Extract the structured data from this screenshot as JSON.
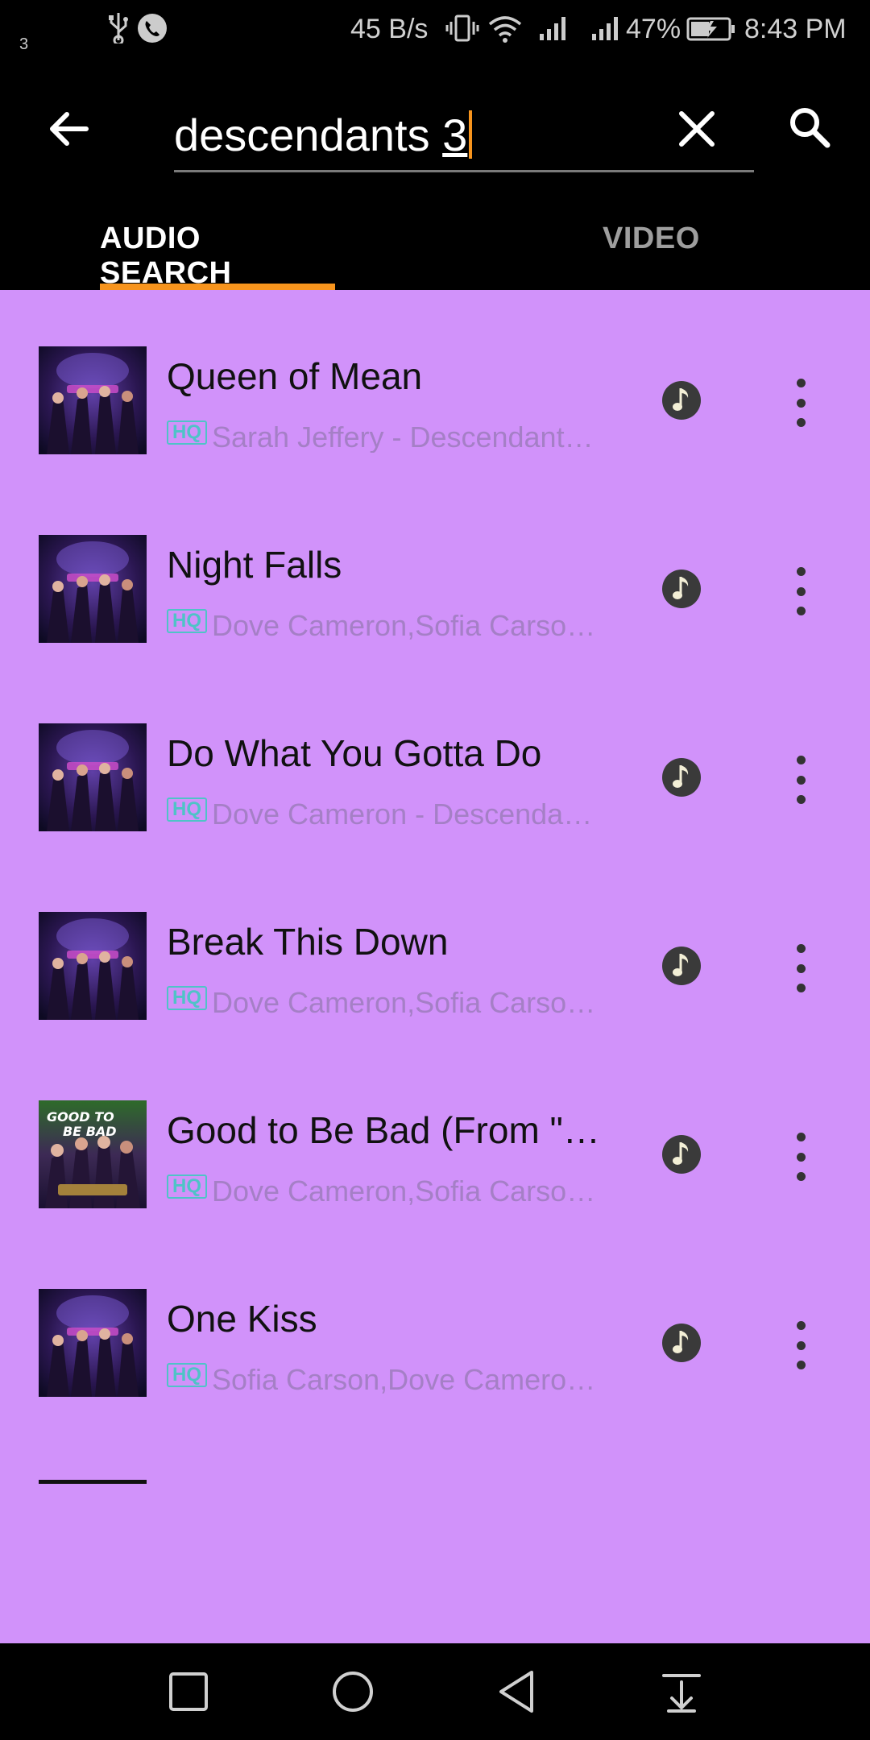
{
  "status": {
    "notif_count": "3",
    "net_speed": "45 B/s",
    "battery": "47%",
    "time": "8:43 PM"
  },
  "search": {
    "query": "descendants ",
    "query_suffix": "3"
  },
  "tabs": [
    {
      "label": "AUDIO SEARCH",
      "active": true
    },
    {
      "label": "VIDEO",
      "active": false
    }
  ],
  "hq_label": "HQ",
  "results": [
    {
      "title": "Queen of Mean",
      "artist": "Sarah Jeffery - Descendants…"
    },
    {
      "title": "Night Falls",
      "artist": "Dove Cameron,Sofia Carson,…"
    },
    {
      "title": "Do What You Gotta Do",
      "artist": "Dove Cameron - Descendant…"
    },
    {
      "title": "Break This Down",
      "artist": "Dove Cameron,Sofia Carson,…"
    },
    {
      "title": "Good to Be Bad (From \"…",
      "artist": "Dove Cameron,Sofia Carson,…"
    },
    {
      "title": "One Kiss",
      "artist": "Sofia Carson,Dove Cameron …"
    }
  ],
  "colors": {
    "accent": "#f7941d",
    "list_bg": "#d192fa",
    "hq": "#4fc3c7"
  },
  "icons": {
    "back": "arrow-left-icon",
    "clear": "close-icon",
    "search": "search-icon",
    "note": "music-note-icon",
    "more": "more-vertical-icon"
  }
}
